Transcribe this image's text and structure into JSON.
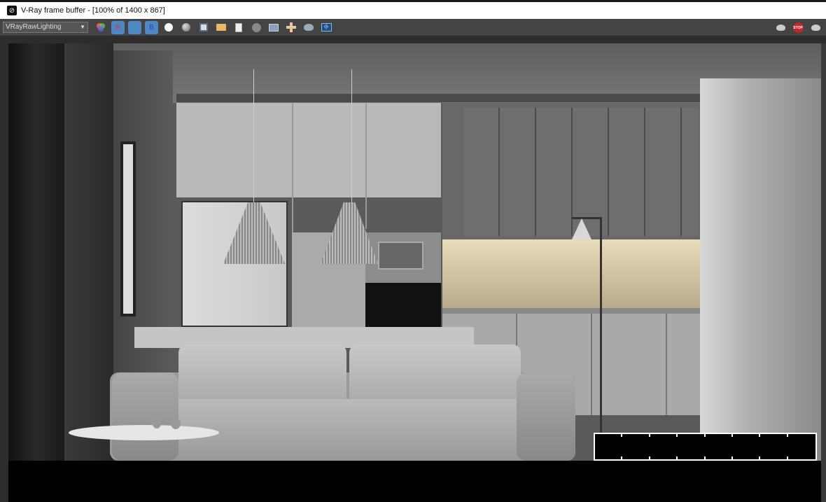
{
  "window": {
    "title": "V-Ray frame buffer - [100% of 1400 x 867]"
  },
  "toolbar": {
    "channel_select": "VRayRawLighting",
    "buttons": [
      {
        "name": "color-channels-icon"
      },
      {
        "name": "red-channel-button",
        "label": "R"
      },
      {
        "name": "green-channel-button",
        "label": "G"
      },
      {
        "name": "blue-channel-button",
        "label": "B"
      },
      {
        "name": "white-circle-icon"
      },
      {
        "name": "gray-circle-icon"
      },
      {
        "name": "save-icon"
      },
      {
        "name": "open-folder-icon"
      },
      {
        "name": "clipboard-icon"
      },
      {
        "name": "clear-icon"
      },
      {
        "name": "compare-icon"
      },
      {
        "name": "region-render-icon"
      },
      {
        "name": "teapot-render-icon"
      },
      {
        "name": "lens-effects-icon"
      }
    ],
    "right_buttons": [
      {
        "name": "render-teapot-icon"
      },
      {
        "name": "stop-render-button",
        "label": "STOP"
      },
      {
        "name": "render-interactive-icon"
      }
    ]
  },
  "colors": {
    "accent": "#4f86c6",
    "stop": "#c0282d",
    "warm_light": "#e9dcb9"
  }
}
